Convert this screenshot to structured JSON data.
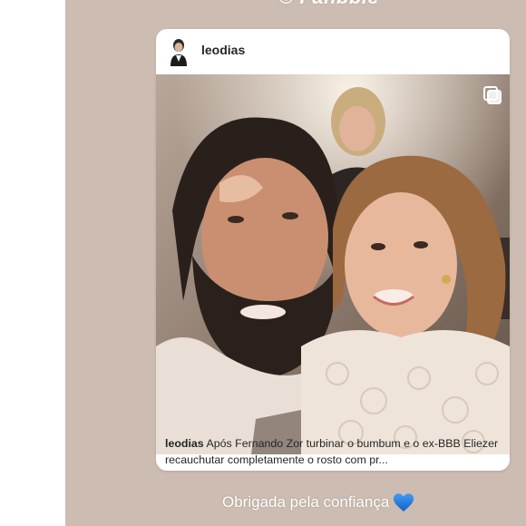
{
  "story": {
    "top_text": "© Fanbble",
    "footer_text": "Obrigada pela confiança",
    "footer_emoji": "blue-heart-icon",
    "background_color": "#cdbcb1"
  },
  "post": {
    "username": "leodias",
    "caption_user": "leodias",
    "caption_text": " Após Fernando Zor turbinar o bumbum e o ex-BBB Eliezer recauchutar completamente o rosto com pr...",
    "multi_media_icon": "carousel-icon",
    "avatar_icon": "profile-avatar"
  },
  "colors": {
    "accent_heart": "#1e7de0",
    "card": "#ffffff",
    "text": "#262626"
  }
}
